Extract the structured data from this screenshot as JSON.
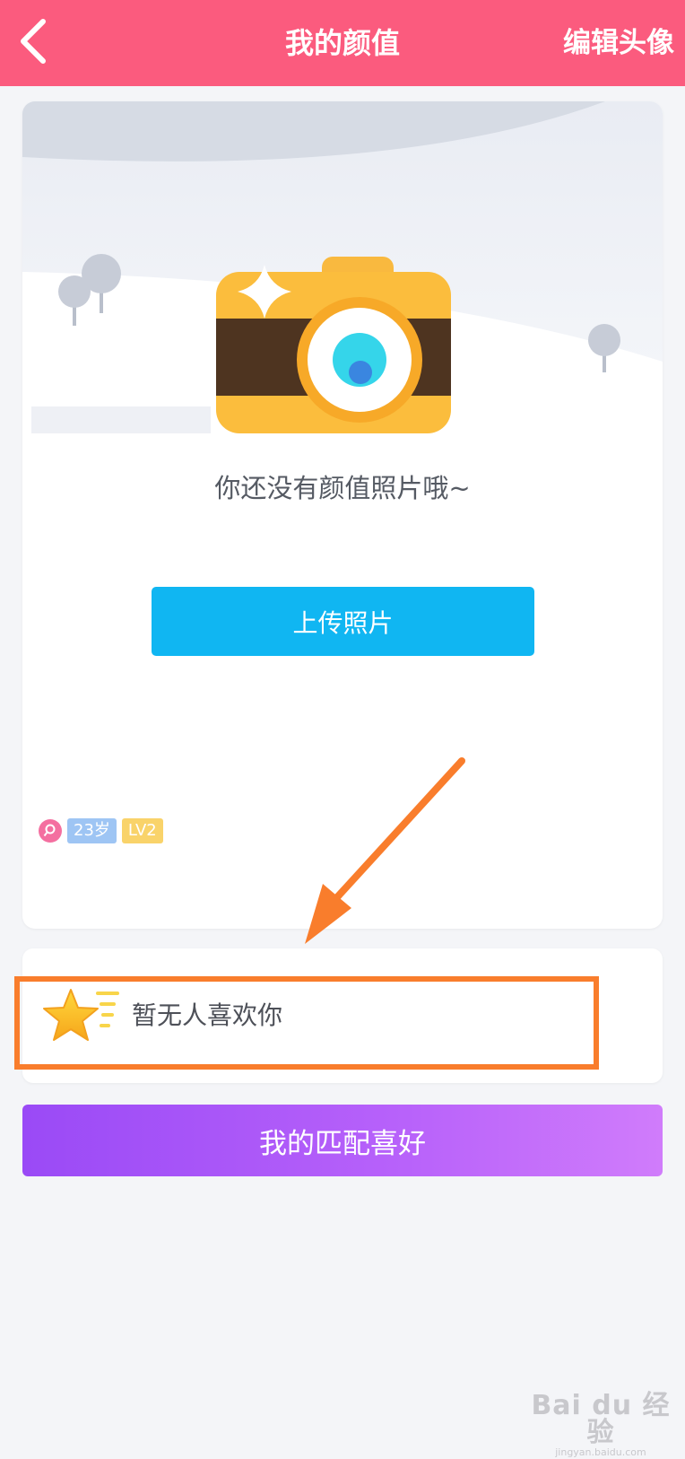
{
  "header": {
    "title": "我的颜值",
    "edit_label": "编辑头像"
  },
  "photo_card": {
    "empty_text": "你还没有颜值照片哦~",
    "upload_button": "上传照片",
    "profile": {
      "age": "23岁",
      "level": "LV2"
    }
  },
  "likes": {
    "text": "暂无人喜欢你"
  },
  "match_button": "我的匹配喜好",
  "watermark": {
    "logo": "Bai du 经验",
    "url": "jingyan.baidu.com"
  },
  "colors": {
    "header": "#fb5b7e",
    "upload_button": "#10b6f2",
    "match_button_start": "#9a4af6",
    "match_button_end": "#d07cfb",
    "annotation": "#f97d2c"
  },
  "icons": {
    "back": "chevron-left-icon",
    "camera": "camera-icon",
    "star": "star-icon",
    "gender": "female-icon"
  }
}
